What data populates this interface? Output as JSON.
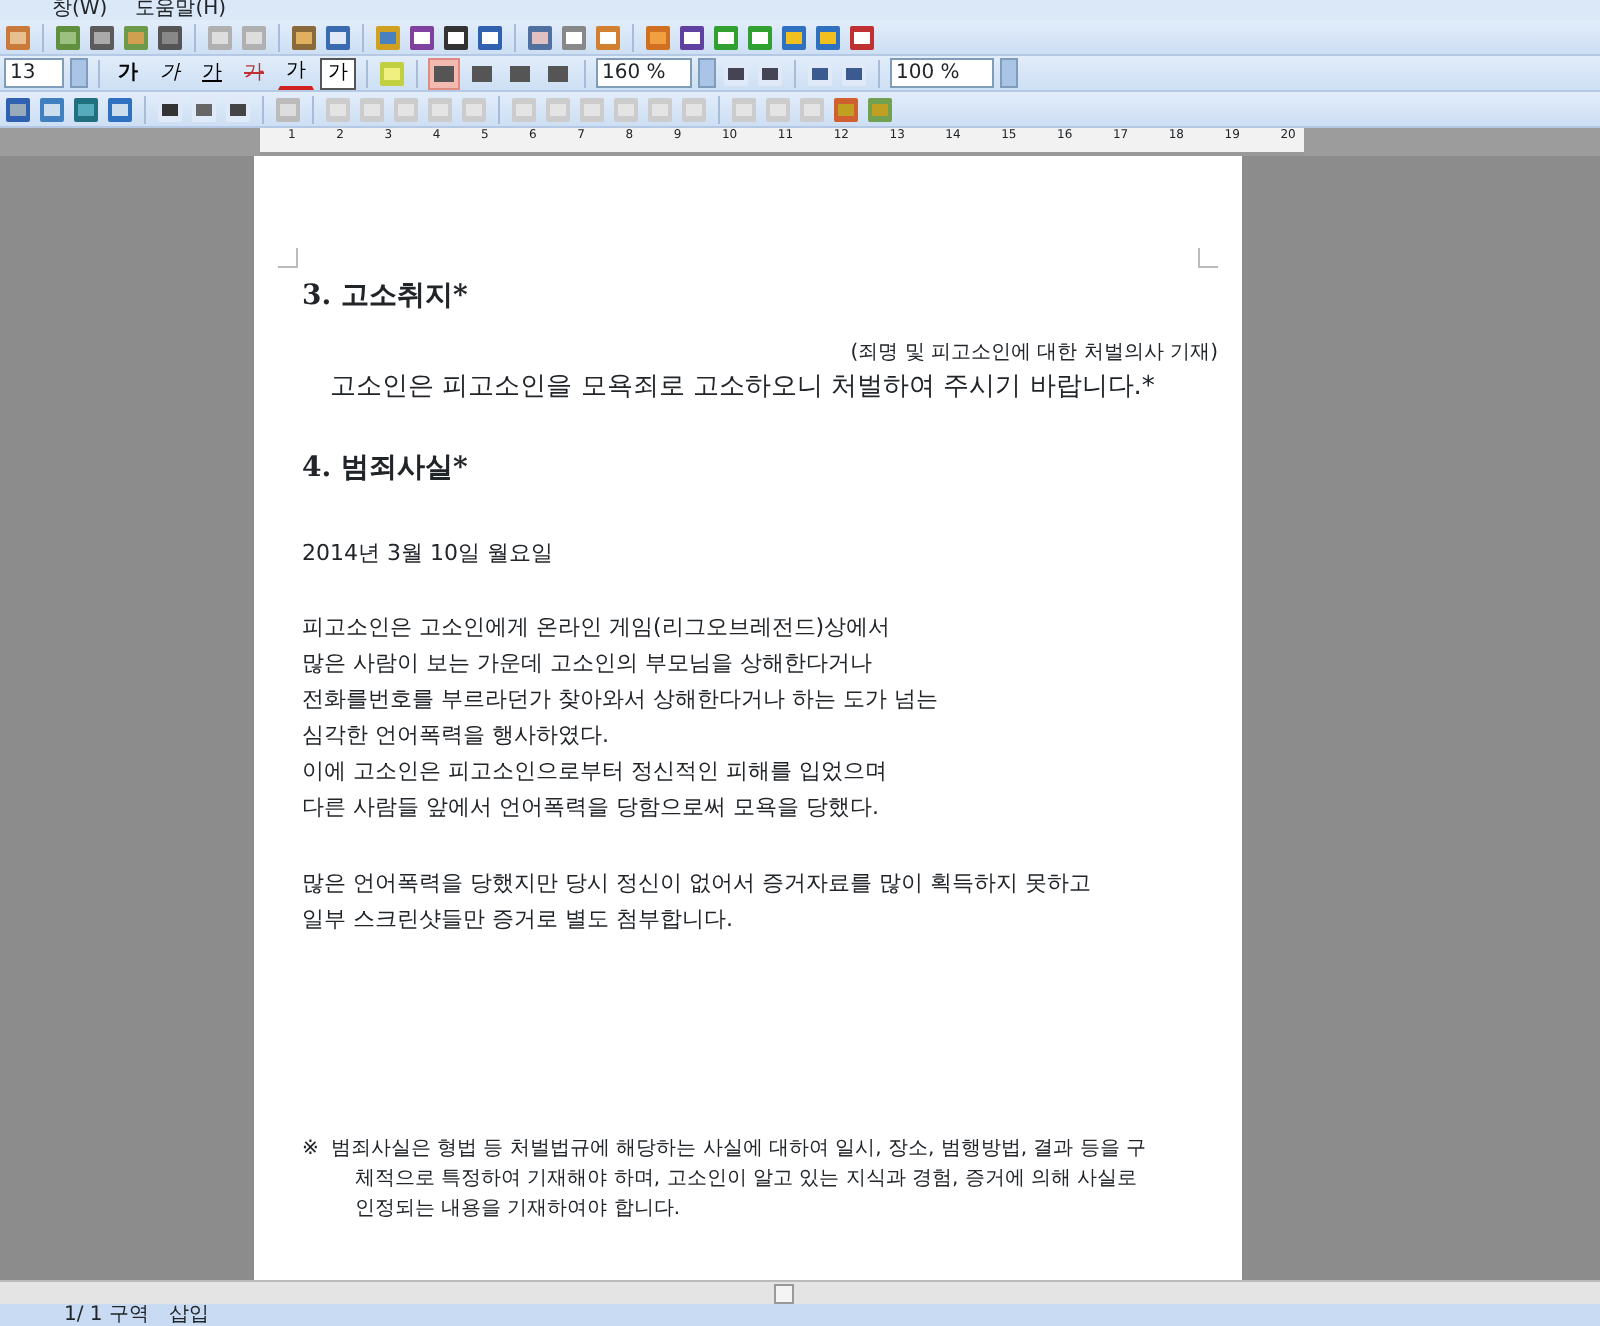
{
  "menu": [
    {
      "label": "창(W)"
    },
    {
      "label": "도움말(H)"
    }
  ],
  "format_toolbar": {
    "font_size": "13",
    "char_buttons": [
      {
        "label": "가",
        "kind": "bold"
      },
      {
        "label": "가",
        "kind": "italic"
      },
      {
        "label": "가",
        "kind": "underline"
      },
      {
        "label": "가",
        "kind": "strike"
      },
      {
        "label": "가",
        "kind": "color"
      }
    ],
    "char_shape": "가",
    "alignment": [
      {
        "selected": true
      },
      {
        "selected": false
      },
      {
        "selected": false
      },
      {
        "selected": false
      }
    ],
    "line_spacing": "160 %",
    "zoom": "100 %"
  },
  "ruler": {
    "ticks": [
      "1",
      "2",
      "3",
      "4",
      "5",
      "6",
      "7",
      "8",
      "9",
      "10",
      "11",
      "12",
      "13",
      "14",
      "15",
      "16",
      "17",
      "18",
      "19",
      "20"
    ]
  },
  "document": {
    "heading_3": "3. 고소취지*",
    "purpose_note": "(죄명 및 피고소인에 대한 처벌의사 기재)",
    "purpose": "고소인은 피고소인을 모욕죄로 고소하오니 처벌하여 주시기 바랍니다.*",
    "heading_4": "4. 범죄사실*",
    "date": "2014년 3월 10일 월요일",
    "paragraphs": [
      [
        "피고소인은 고소인에게 온라인 게임(리그오브레전드)상에서",
        "많은 사람이 보는 가운데 고소인의 부모님을 상해한다거나",
        "전화를번호를 부르라던가 찾아와서 상해한다거나 하는 도가 넘는",
        "심각한 언어폭력을 행사하였다.",
        "이에 고소인은 피고소인으로부터 정신적인 피해를 입었으며",
        "다른 사람들 앞에서 언어폭력을 당함으로써 모욕을 당했다."
      ],
      [
        "많은 언어폭력을 당했지만 당시 정신이 없어서 증거자료를 많이 획득하지 못하고",
        "일부 스크린샷들만 증거로 별도 첨부합니다."
      ]
    ],
    "footnote": {
      "mark": "※",
      "lines": [
        "범죄사실은 형법 등 처벌법규에 해당하는 사실에 대하여 일시, 장소, 범행방법, 결과 등을 구",
        "체적으로 특정하여 기재해야 하며, 고소인이 알고 있는 지식과 경험, 증거에 의해 사실로",
        "인정되는 내용을 기재하여야 합니다."
      ]
    }
  },
  "status_bar": {
    "page": "1/ 1 구역",
    "mode": "삽입"
  }
}
